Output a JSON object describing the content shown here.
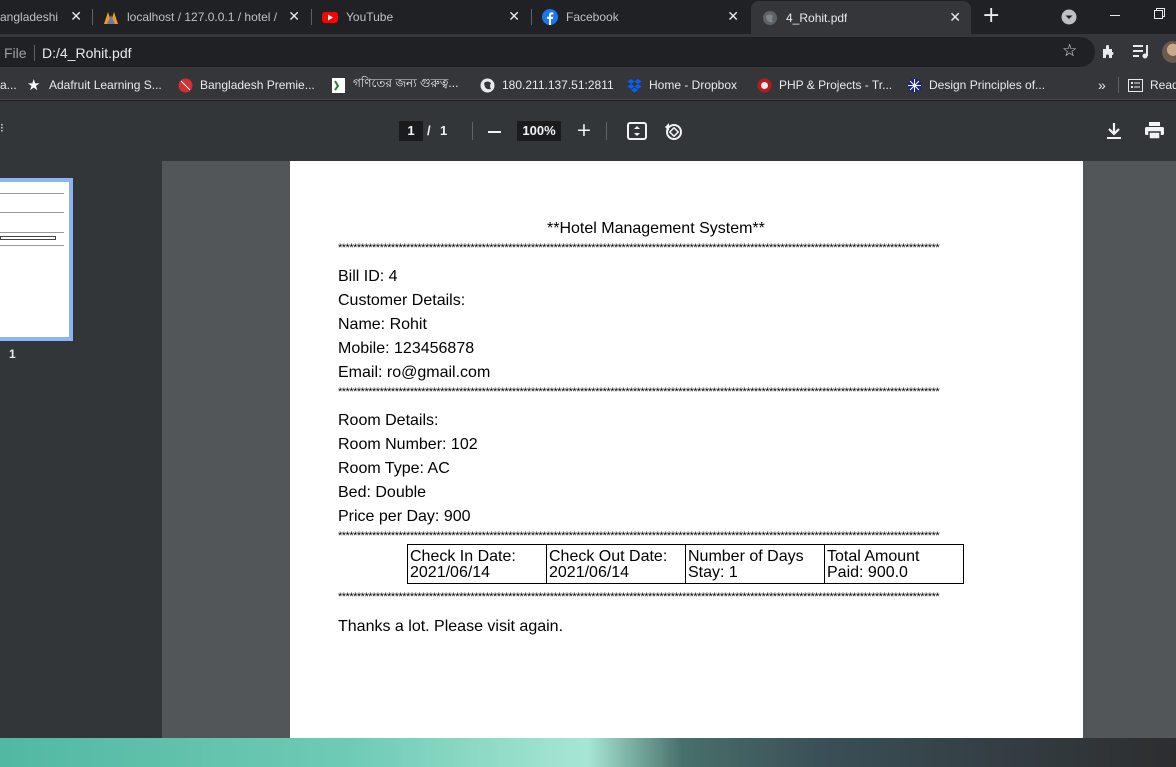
{
  "tabs": [
    {
      "title": "angladeshi c",
      "icon": "tab-favicon-partial",
      "active": false
    },
    {
      "title": "localhost / 127.0.0.1 / hotel /",
      "icon": "phpmyadmin-icon",
      "active": false
    },
    {
      "title": "YouTube",
      "icon": "youtube-icon",
      "active": false
    },
    {
      "title": "Facebook",
      "icon": "facebook-icon",
      "active": false
    },
    {
      "title": "4_Rohit.pdf",
      "icon": "globe-icon",
      "active": true
    }
  ],
  "omnibox": {
    "scheme": "File",
    "url": "D:/4_Rohit.pdf"
  },
  "bookmarks": [
    {
      "label": "a...",
      "icon": "bookmark-favicon"
    },
    {
      "label": "Adafruit Learning S...",
      "icon": "adafruit-star-icon"
    },
    {
      "label": "Bangladesh Premie...",
      "icon": "cricket-ball-icon"
    },
    {
      "label": "গণিতের জন্য গুরুত্ব...",
      "icon": "math-book-icon"
    },
    {
      "label": "180.211.137.51:2811",
      "icon": "globe-icon"
    },
    {
      "label": "Home - Dropbox",
      "icon": "dropbox-icon"
    },
    {
      "label": "PHP & Projects - Tr...",
      "icon": "php-icon"
    },
    {
      "label": "Design Principles of...",
      "icon": "design-icon"
    }
  ],
  "bookmarks_overflow": "»",
  "reading_list_label": "Read",
  "pdf_toolbar": {
    "current_page": "1",
    "page_sep": "/",
    "total_pages": "1",
    "zoom": "100%"
  },
  "thumbnail": {
    "page_label": "1"
  },
  "document": {
    "title": "**Hotel Management System**",
    "divider": "***************************************************************************************************************************************************************",
    "bill_id": "Bill ID: 4",
    "customer_header": "Customer Details:",
    "name": "Name: Rohit",
    "mobile": "Mobile: 123456878",
    "email": "Email: ro@gmail.com",
    "room_header": "Room Details:",
    "room_number": "Room Number: 102",
    "room_type": "Room Type: AC",
    "bed": "Bed: Double",
    "price": "Price per Day: 900",
    "table": [
      [
        "Check In Date:",
        "2021/06/14"
      ],
      [
        "Check Out Date:",
        "2021/06/14"
      ],
      [
        "Number of Days",
        "Stay: 1"
      ],
      [
        "Total Amount",
        "Paid: 900.0"
      ]
    ],
    "thanks": "Thanks a lot. Please visit again."
  },
  "colors": {
    "accent": "#8ab4f8",
    "toolbar": "#323639",
    "viewer": "#525659"
  }
}
